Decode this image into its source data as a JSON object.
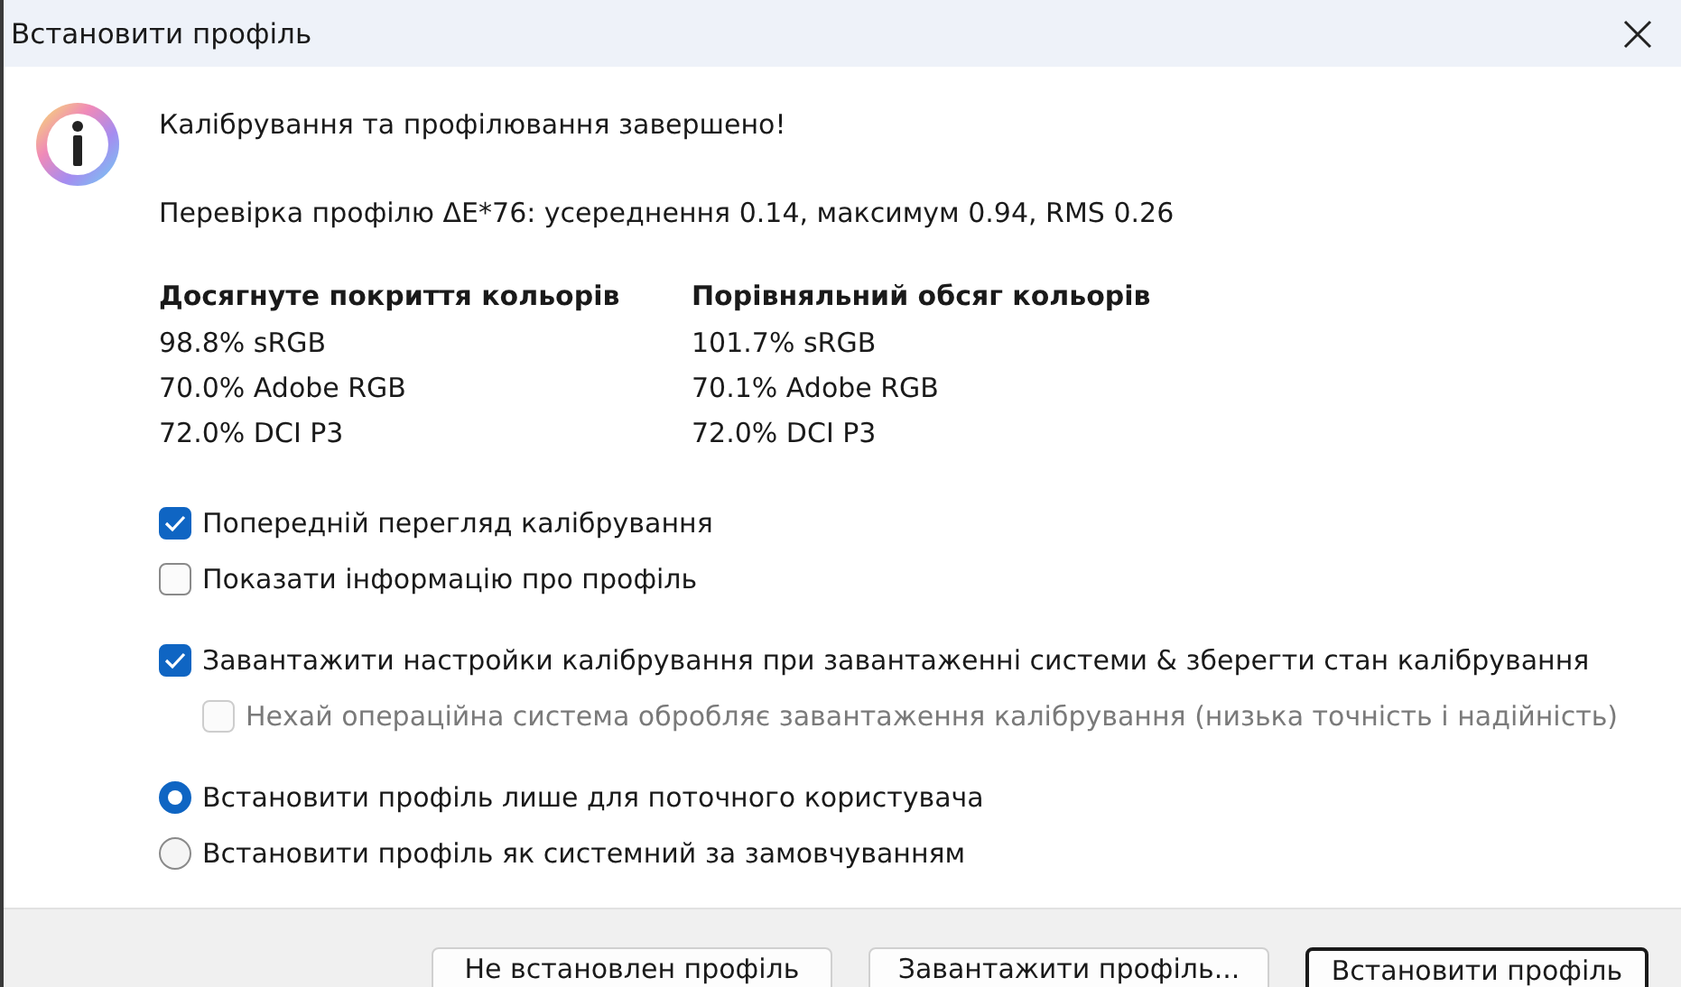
{
  "window": {
    "title": "Встановити профіль"
  },
  "message": {
    "heading": "Калібрування та профілювання завершено!",
    "verification": "Перевірка профілю ΔE*76: усереднення 0.14, максимум 0.94, RMS 0.26"
  },
  "gamut_columns": [
    {
      "title": "Досягнуте покриття кольорів",
      "rows": [
        "98.8% sRGB",
        "70.0% Adobe RGB",
        "72.0% DCI P3"
      ]
    },
    {
      "title": "Порівняльний обсяг кольорів",
      "rows": [
        "101.7% sRGB",
        "70.1% Adobe RGB",
        "72.0% DCI P3"
      ]
    }
  ],
  "option_groups": [
    [
      {
        "kind": "checkbox",
        "label": "Попередній перегляд калібрування",
        "checked": true,
        "disabled": false
      },
      {
        "kind": "checkbox",
        "label": "Показати інформацію про профіль",
        "checked": false,
        "disabled": false
      }
    ],
    [
      {
        "kind": "checkbox",
        "label": "Завантажити настройки калібрування при завантаженні системи & зберегти стан калібрування",
        "checked": true,
        "disabled": false,
        "children": [
          {
            "kind": "checkbox",
            "label": "Нехай операційна система обробляє завантаження калібрування (низька точність і надійність)",
            "checked": false,
            "disabled": true
          }
        ]
      }
    ],
    [
      {
        "kind": "radio",
        "label": "Встановити профіль лише для поточного користувача",
        "selected": true,
        "disabled": false
      },
      {
        "kind": "radio",
        "label": "Встановити профіль як системний за замовчуванням",
        "selected": false,
        "disabled": false
      }
    ]
  ],
  "buttons": [
    {
      "label": "Не встановлен профіль",
      "default": false
    },
    {
      "label": "Завантажити профіль...",
      "default": false
    },
    {
      "label": "Встановити профіль",
      "default": true
    }
  ]
}
